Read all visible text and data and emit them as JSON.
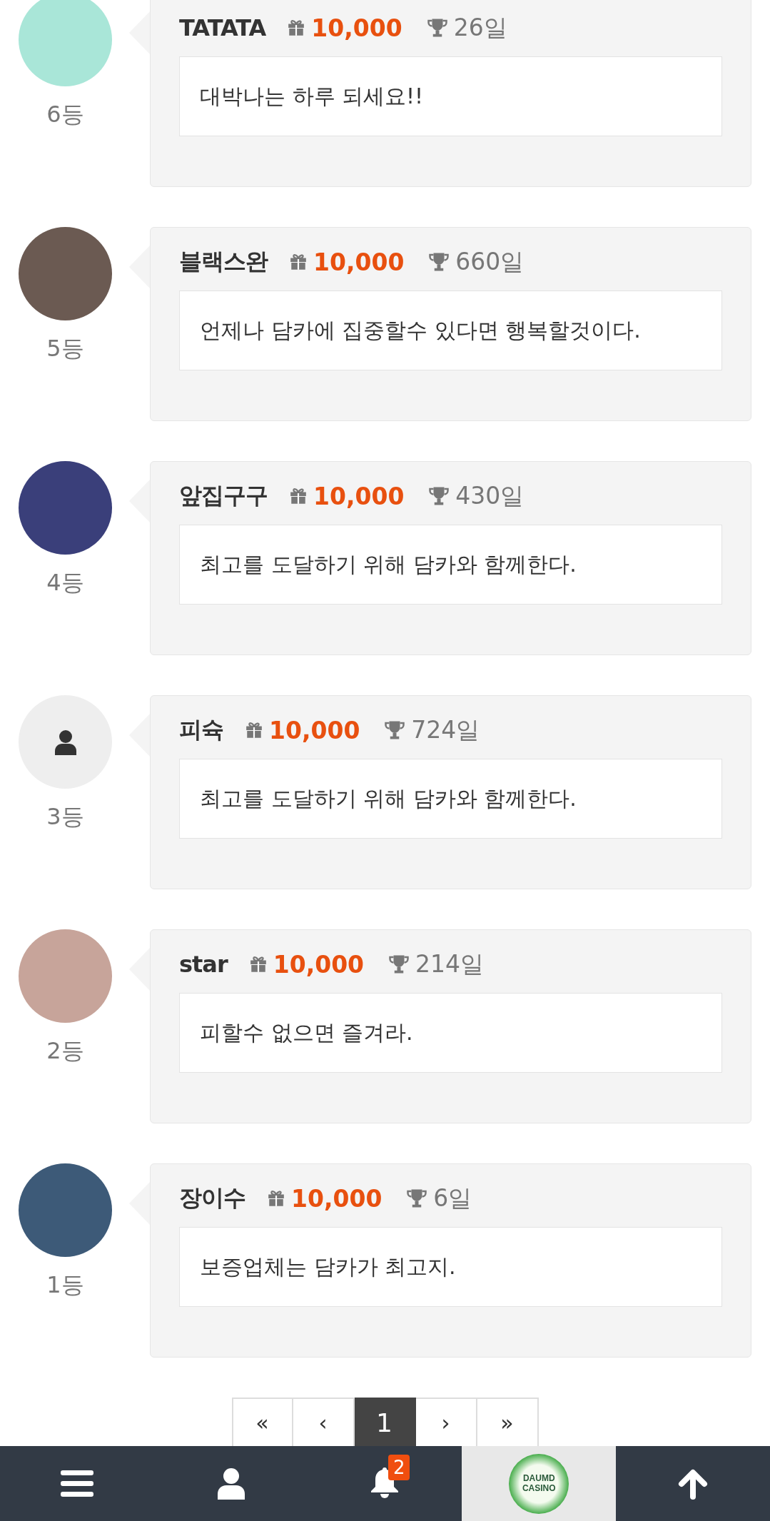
{
  "entries": [
    {
      "default_avatar": false,
      "rank": "6등",
      "name": "TATATA",
      "points": "10,000",
      "days": "26일",
      "message": "대박나는 하루 되세요!!"
    },
    {
      "default_avatar": false,
      "rank": "5등",
      "name": "블랙스완",
      "points": "10,000",
      "days": "660일",
      "message": "언제나 담카에 집중할수 있다면 행복할것이다."
    },
    {
      "default_avatar": false,
      "rank": "4등",
      "name": "앞집구구",
      "points": "10,000",
      "days": "430일",
      "message": "최고를 도달하기 위해 담카와 함께한다."
    },
    {
      "default_avatar": true,
      "rank": "3등",
      "name": "피슉",
      "points": "10,000",
      "days": "724일",
      "message": "최고를 도달하기 위해 담카와 함께한다."
    },
    {
      "default_avatar": false,
      "rank": "2등",
      "name": "star",
      "points": "10,000",
      "days": "214일",
      "message": "피할수 없으면 즐겨라."
    },
    {
      "default_avatar": false,
      "rank": "1등",
      "name": "장이수",
      "points": "10,000",
      "days": "6일",
      "message": "보증업체는 담카가 최고지."
    }
  ],
  "pagination": [
    {
      "kind": "first",
      "label": "«",
      "selected": false
    },
    {
      "kind": "prev",
      "label": "‹",
      "selected": false
    },
    {
      "kind": "page",
      "label": "1",
      "selected": true
    },
    {
      "kind": "next",
      "label": "›",
      "selected": false
    },
    {
      "kind": "last",
      "label": "»",
      "selected": false
    }
  ],
  "bottom_nav": [
    {
      "kind": "menu"
    },
    {
      "kind": "user"
    },
    {
      "kind": "bell",
      "badge": "2"
    },
    {
      "kind": "logo",
      "logo_lines": [
        "DAUMD",
        "CASINO"
      ]
    },
    {
      "kind": "top"
    }
  ]
}
